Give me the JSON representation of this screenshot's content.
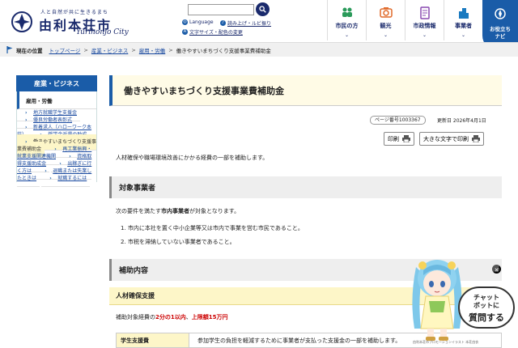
{
  "header": {
    "tagline": "人と自然が共に生きるまち",
    "city_name": "由利本荘市",
    "city_roman": "Yurihonjo City",
    "search_placeholder": "",
    "language_label": "Language",
    "ruby_label": "読み上げ・ルビ振り",
    "text_size_label": "文字サイズ・配色の変更",
    "nav": [
      {
        "label": "市民の方",
        "icon": "people-icon"
      },
      {
        "label": "観光",
        "icon": "camera-icon"
      },
      {
        "label": "市政情報",
        "icon": "document-icon"
      },
      {
        "label": "事業者",
        "icon": "building-icon"
      }
    ],
    "useful_label_1": "お役立ち",
    "useful_label_2": "ナビ"
  },
  "breadcrumb": {
    "here_label": "現在の位置",
    "items": [
      "トップページ",
      "産業・ビジネス",
      "雇用・労働",
      "働きやすいまちづくり支援事業費補助金"
    ],
    "sep": ">"
  },
  "sidebar": {
    "header": "産業・ビジネス",
    "current": "雇用・労働",
    "items": [
      "地方就職学生支援金",
      "優良労働者表彰式",
      "新着求人（ハローワーク本荘）",
      "奨学金返還の助成",
      "働きやすいまちづくり支援事業費補助金",
      "再工業振興・就業支援関連機関",
      "資格取得支援助成金",
      "出稼ぎに行く方は",
      "退職または失業したときは",
      "就職するには"
    ]
  },
  "main": {
    "title": "働きやすいまちづくり支援事業費補助金",
    "page_number": "ページ番号1003367",
    "updated": "更新日 2026年4月1日",
    "print_label": "印刷",
    "large_print_label": "大きな文字で印刷",
    "lead": "人材確保や職場環境改善にかかる経費の一部を補助します。",
    "section1_title": "対象事業者",
    "section1_intro_pre": "次の要件を満たす",
    "section1_intro_bold": "市内事業者",
    "section1_intro_post": "が対象となります。",
    "section1_items": [
      "1. 市内に本社を置く中小企業等又は市内で事業を営む市民であること。",
      "2. 市税を滞納していない事業者であること。"
    ],
    "section2_title": "補助内容",
    "subsection_title": "人材確保支援",
    "subsidy_pre": "補助対象経費の",
    "subsidy_rate": "2分の1以内",
    "subsidy_mid": "、",
    "subsidy_limit": "上限額15万円",
    "table_header": "学生支援費",
    "table_cell": "参加学生の負担を軽減するために事業者が支払った支援金の一部を補助します。"
  },
  "chatbot": {
    "line1": "チャット",
    "line2": "ボットに",
    "line3": "質問する",
    "credit": "由利本荘市プロモーションイラスト 本荘由衣"
  },
  "colors": {
    "brand_navy": "#1a2a6c",
    "accent_blue": "#1a5ca8",
    "highlight_yellow": "#fdf6c8",
    "alert_red": "#cc0000"
  }
}
